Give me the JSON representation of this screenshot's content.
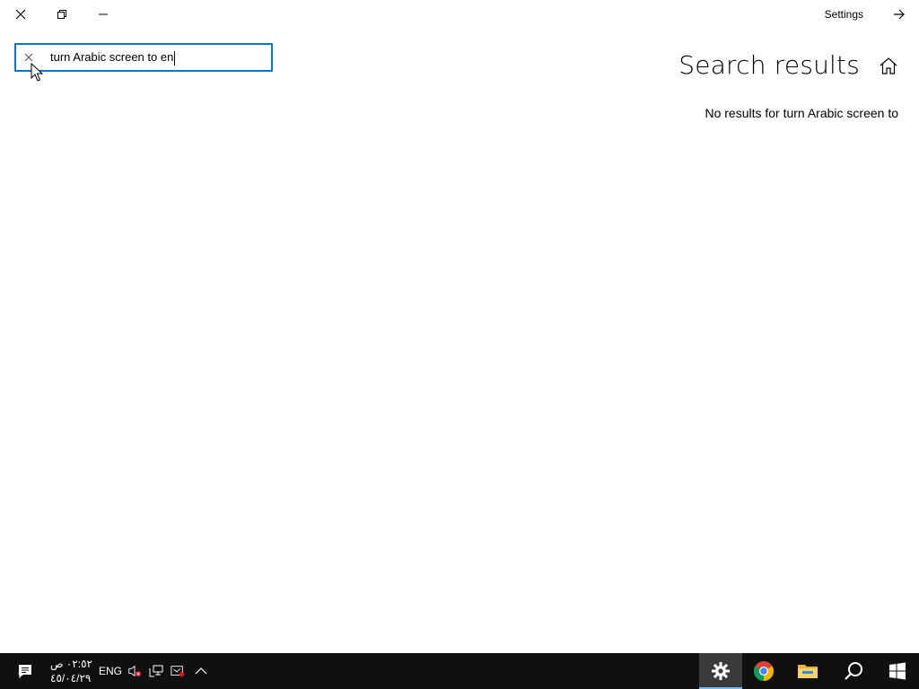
{
  "window": {
    "title": "Settings",
    "controls": [
      "close",
      "restore",
      "minimize"
    ]
  },
  "search": {
    "value": "turn Arabic screen to en"
  },
  "main": {
    "title": "Search results",
    "message": "No results for turn Arabic screen to"
  },
  "taskbar": {
    "language": "ENG",
    "time": "٠٢:٥٢ ص",
    "date": "٤٥/٠٤/٢٩",
    "notification_count": "٣",
    "pinned": [
      "settings",
      "chrome",
      "file-explorer",
      "search",
      "start"
    ],
    "active": "settings",
    "colors": {
      "background": "#101010",
      "active": "#3a3a3a",
      "accent": "#76b9ed"
    }
  },
  "colors": {
    "accent": "#0078d7"
  }
}
